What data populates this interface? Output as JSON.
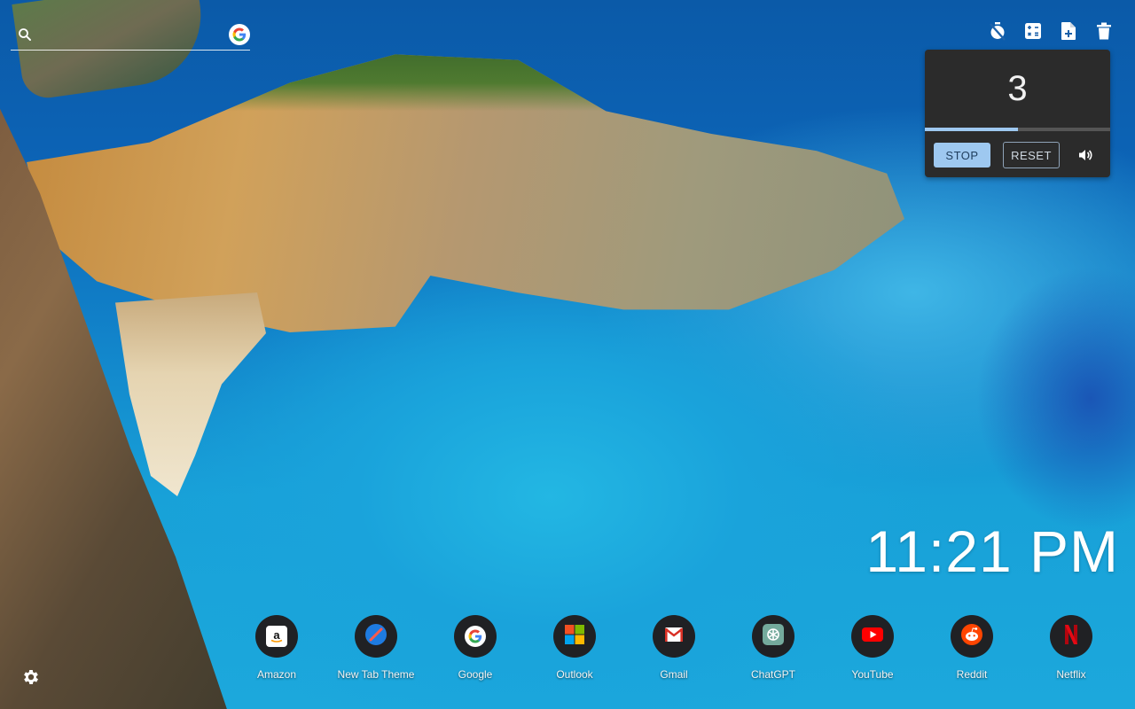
{
  "search": {
    "placeholder": "",
    "icon": "search-icon",
    "engine_icon": "google-icon",
    "engine_letter": "G"
  },
  "toolbar": {
    "items": [
      {
        "name": "timer-off-icon"
      },
      {
        "name": "calculator-icon"
      },
      {
        "name": "note-add-icon"
      },
      {
        "name": "trash-icon"
      }
    ]
  },
  "timer": {
    "value": "3",
    "progress": 0.5,
    "stop_label": "STOP",
    "reset_label": "RESET",
    "volume_icon": "volume-icon",
    "accent": "#9ec8f0"
  },
  "clock": {
    "time": "11:21 PM"
  },
  "shortcuts": [
    {
      "label": "Amazon",
      "icon": "amazon-icon"
    },
    {
      "label": "New Tab Theme",
      "icon": "new-tab-theme-icon"
    },
    {
      "label": "Google",
      "icon": "google-icon"
    },
    {
      "label": "Outlook",
      "icon": "outlook-icon"
    },
    {
      "label": "Gmail",
      "icon": "gmail-icon"
    },
    {
      "label": "ChatGPT",
      "icon": "chatgpt-icon"
    },
    {
      "label": "YouTube",
      "icon": "youtube-icon"
    },
    {
      "label": "Reddit",
      "icon": "reddit-icon"
    },
    {
      "label": "Netflix",
      "icon": "netflix-icon"
    }
  ],
  "settings": {
    "icon": "gear-icon"
  }
}
